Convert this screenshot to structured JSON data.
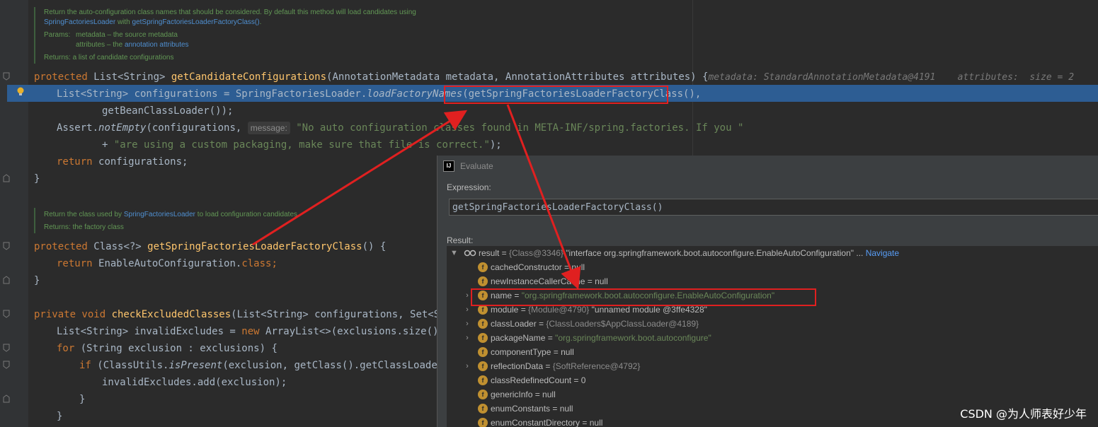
{
  "editor": {
    "doc1": {
      "line1": "Return the auto-configuration class names that should be considered. By default this method will load candidates using",
      "line2_link": "SpringFactoriesLoader",
      "line2_mid": " with ",
      "line2_link2": "getSpringFactoriesLoaderFactoryClass()",
      "line2_end": ".",
      "params_label": "Params:",
      "param1": "metadata – the source metadata",
      "param2_pre": "attributes – the ",
      "param2_link": "annotation attributes",
      "returns": "Returns: a list of candidate configurations"
    },
    "line1": {
      "kw": "protected ",
      "type": "List<String> ",
      "fn": "getCandidateConfigurations",
      "args": "(AnnotationMetadata metadata, AnnotationAttributes attributes) {",
      "hint": "metadata: StandardAnnotationMetadata@4191    attributes:  size = 2"
    },
    "line2": {
      "pre": "List<String> configurations = SpringFactoriesLoader.",
      "it": "loadFactoryNames",
      "post": "(getSpringFactoriesLoaderFactoryClass(),"
    },
    "line3": "getBeanClassLoader());",
    "line4": {
      "pre": "Assert.",
      "it": "notEmpty",
      "mid": "(configurations, ",
      "hint": "message:",
      "str": "\"No auto configuration classes found in META-INF/spring.factories. If you \""
    },
    "line5": {
      "pre": "+ ",
      "str": "\"are using a custom packaging, make sure that file is correct.\"",
      "post": ");"
    },
    "line6": {
      "kw": "return ",
      "rest": "configurations;"
    },
    "line7": "}",
    "doc2": {
      "line1_pre": "Return the class used by ",
      "line1_link": "SpringFactoriesLoader",
      "line1_post": " to load configuration candidates.",
      "returns": "Returns: the factory class"
    },
    "line8": {
      "kw": "protected ",
      "type": "Class<?> ",
      "fn": "getSpringFactoriesLoaderFactoryClass",
      "post": "() {"
    },
    "line9": {
      "kw": "return ",
      "rest": "EnableAutoConfiguration.",
      "kw2": "class",
      "end": ";"
    },
    "line10": "}",
    "line11": {
      "kw": "private void ",
      "fn": "checkExcludedClasses",
      "post": "(List<String> configurations, Set<Strin"
    },
    "line12": {
      "pre": "List<String> invalidExcludes = ",
      "kw": "new ",
      "post": "ArrayList<>(exclusions.size());"
    },
    "line13": {
      "kw": "for ",
      "post": "(String exclusion : exclusions) {"
    },
    "line14": {
      "kw": "if ",
      "pre": "(ClassUtils.",
      "it": "isPresent",
      "post": "(exclusion, getClass().getClassLoader()"
    },
    "line15": "invalidExcludes.add(exclusion);",
    "line16": "}",
    "line17": "}"
  },
  "evaluate": {
    "title": "Evaluate",
    "icon": "IJ",
    "expression_label": "Expression:",
    "expression": "getSpringFactoriesLoaderFactoryClass()",
    "result_label": "Result:",
    "result_row": {
      "name": "result",
      "eq": " = ",
      "type": "{Class@3346} ",
      "value": "\"interface org.springframework.boot.autoconfigure.EnableAutoConfiguration\"",
      "ellipsis": " ... ",
      "navigate": "Navigate"
    },
    "fields": [
      {
        "name": "cachedConstructor",
        "rest": " = null",
        "expandable": false
      },
      {
        "name": "newInstanceCallerCache",
        "rest": " = null",
        "expandable": false
      },
      {
        "name": "name",
        "rest": " = ",
        "str": "\"org.springframework.boot.autoconfigure.EnableAutoConfiguration\"",
        "expandable": true
      },
      {
        "name": "module",
        "rest": " = ",
        "type": "{Module@4790} ",
        "str2": "\"unnamed module @3ffe4328\"",
        "expandable": true
      },
      {
        "name": "classLoader",
        "rest": " = ",
        "type": "{ClassLoaders$AppClassLoader@4189}",
        "expandable": true
      },
      {
        "name": "packageName",
        "rest": " = ",
        "str": "\"org.springframework.boot.autoconfigure\"",
        "expandable": true
      },
      {
        "name": "componentType",
        "rest": " = null",
        "expandable": false
      },
      {
        "name": "reflectionData",
        "rest": " = ",
        "type": "{SoftReference@4792}",
        "expandable": true
      },
      {
        "name": "classRedefinedCount",
        "rest": " = 0",
        "expandable": false
      },
      {
        "name": "genericInfo",
        "rest": " = null",
        "expandable": false
      },
      {
        "name": "enumConstants",
        "rest": " = null",
        "expandable": false
      },
      {
        "name": "enumConstantDirectory",
        "rest": " = null",
        "expandable": false
      }
    ],
    "field_icon": "f"
  },
  "watermark": "CSDN @为人师表好少年",
  "colors": {
    "accent_red": "#e02020",
    "selection": "#2d5d93"
  }
}
